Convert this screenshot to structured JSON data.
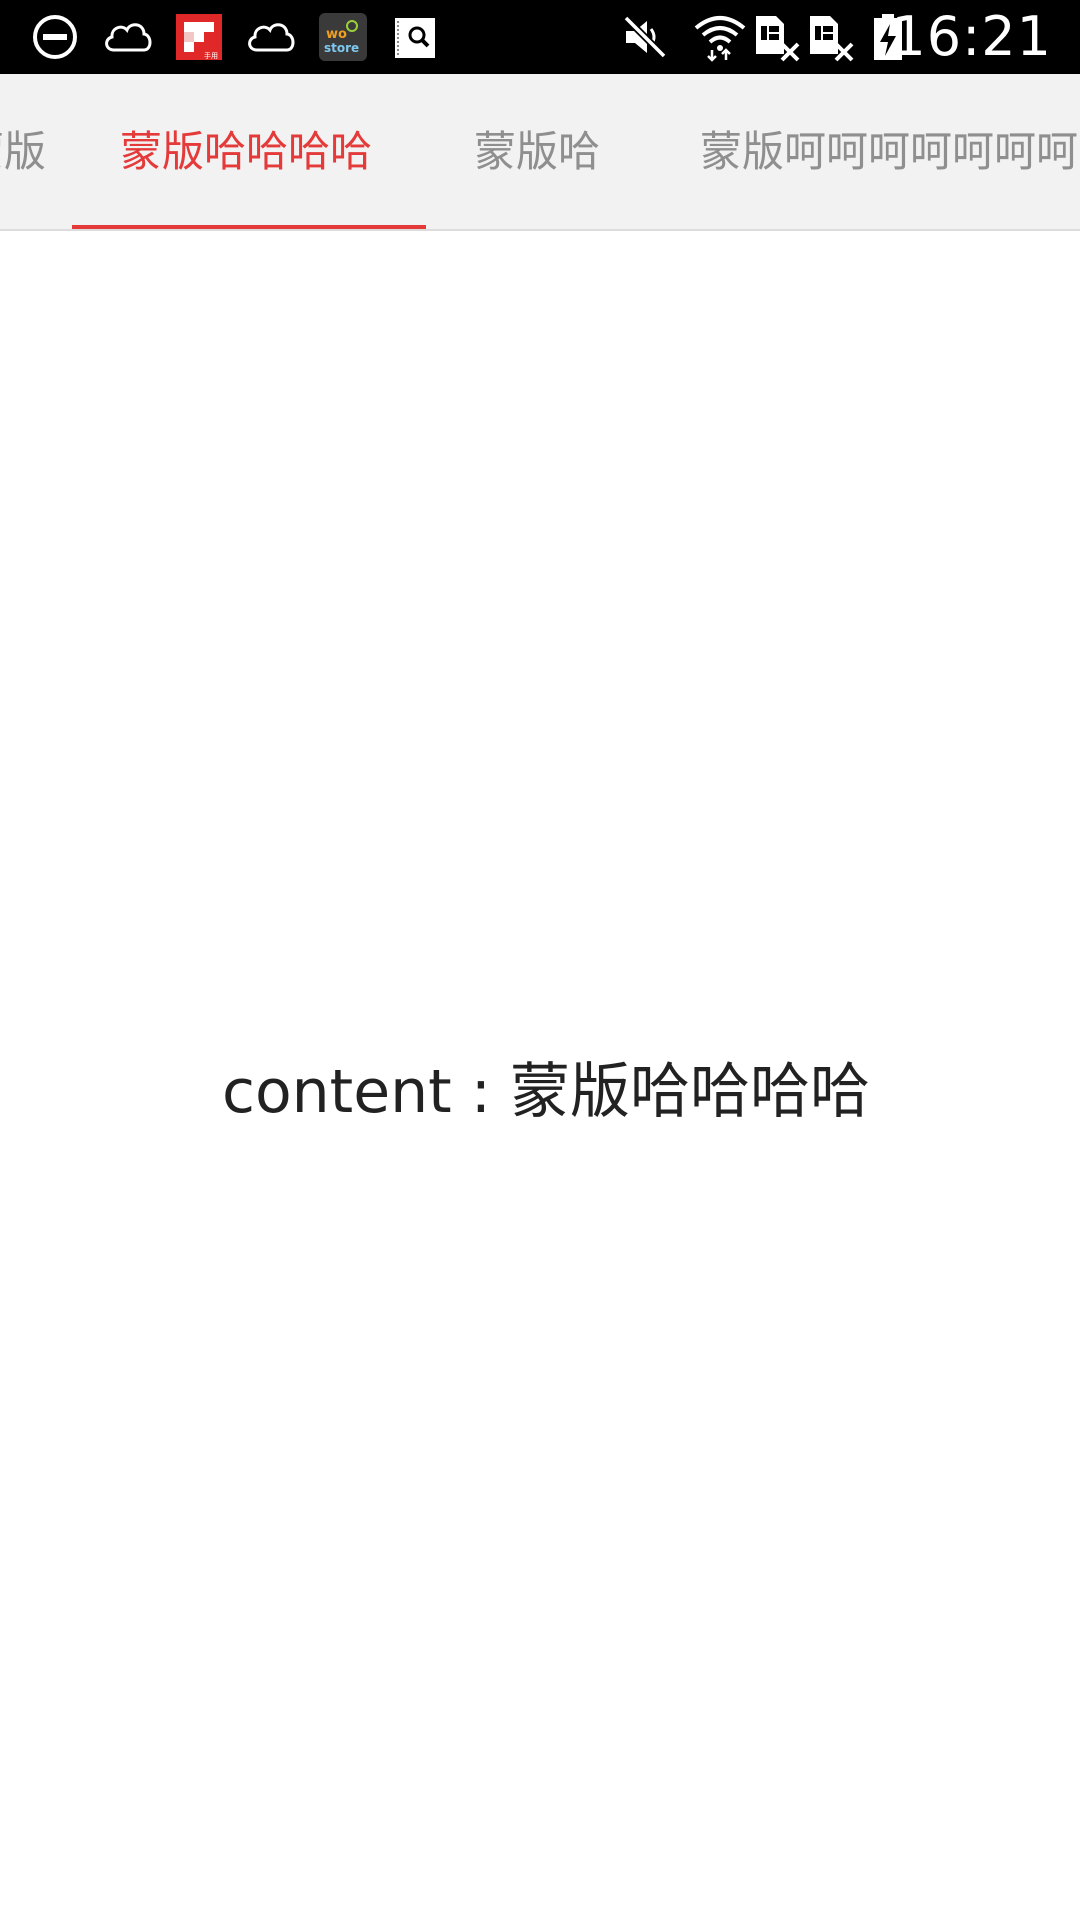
{
  "status_bar": {
    "time": "16:21",
    "left_icons": [
      "do-not-disturb-icon",
      "weather-cloud-icon",
      "flipboard-app-icon",
      "weather-cloud-icon",
      "wostore-app-icon",
      "search-app-icon"
    ],
    "right_icons": [
      "volume-muted-icon",
      "wifi-icon",
      "sim1-no-signal-icon",
      "sim2-no-signal-icon",
      "battery-charging-icon"
    ],
    "flipboard_label": "手用",
    "wostore_label": "wo store"
  },
  "tabs": [
    {
      "label": "蒙版",
      "active": false
    },
    {
      "label": "蒙版哈哈哈哈",
      "active": true
    },
    {
      "label": "蒙版哈",
      "active": false
    },
    {
      "label": "蒙版呵呵呵呵呵呵呵呵",
      "active": false
    }
  ],
  "content": {
    "text": "content : 蒙版哈哈哈哈"
  },
  "colors": {
    "accent": "#e53a3a",
    "tab_inactive": "#8f8f8f",
    "tab_bar_bg": "#f2f2f2",
    "status_bar_bg": "#000000",
    "content_text": "#222222"
  }
}
